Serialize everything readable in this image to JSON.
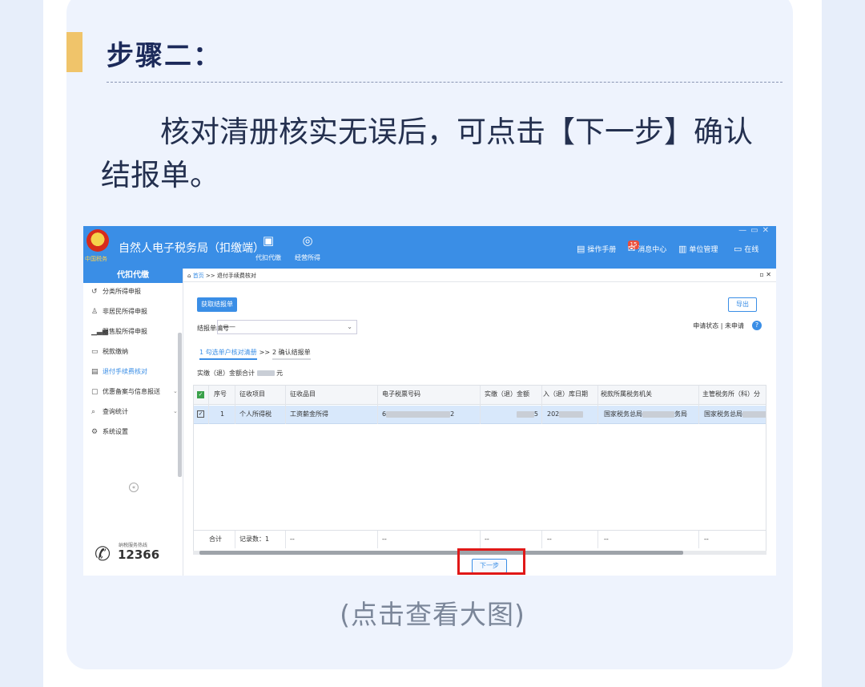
{
  "article": {
    "step_title": "步骤二：",
    "paragraph": "核对清册核实无误后，可点击【下一步】确认结报单。",
    "caption": "(点击查看大图)"
  },
  "app": {
    "title": "自然人电子税务局（扣缴端）",
    "logo_text": "中国税务",
    "nav": [
      {
        "icon": "wallet-icon",
        "label": "代扣代缴"
      },
      {
        "icon": "coins-icon",
        "label": "经营所得"
      }
    ],
    "top_right": {
      "manual": "操作手册",
      "messages": "消息中心",
      "message_count": "15",
      "unit_mgmt": "单位管理",
      "online": "在线"
    },
    "window_controls": [
      "—",
      "▭",
      "✕"
    ]
  },
  "sidebar": {
    "header": "代扣代缴",
    "items": [
      {
        "icon": "refresh-icon",
        "label": "分类所得申报"
      },
      {
        "icon": "person-icon",
        "label": "非居民所得申报"
      },
      {
        "icon": "bar-chart-icon",
        "label": "限售股所得申报"
      },
      {
        "icon": "card-icon",
        "label": "税款缴纳"
      },
      {
        "icon": "doc-icon",
        "label": "退付手续费核对"
      },
      {
        "icon": "doc-icon",
        "label": "优惠备案与信息报送"
      },
      {
        "icon": "search-icon",
        "label": "查询统计"
      },
      {
        "icon": "gear-icon",
        "label": "系统设置"
      }
    ],
    "hotline_label": "纳税服务热线",
    "hotline_number": "12366"
  },
  "main": {
    "breadcrumb_home": "首页",
    "breadcrumb_sep": ">>",
    "breadcrumb_page": "退付手续费核对",
    "get_button": "获取结报单",
    "export_button": "导出",
    "report_no_label": "结报单编号",
    "report_no_value": "——",
    "status_label": "申请状态",
    "status_sep": "|",
    "status_value": "未申请",
    "step1": "1 勾选单户核对清册",
    "step_arrow": ">>",
    "step2": "2 确认结报单",
    "total_label": "实缴（退）金额合计",
    "total_unit": "元",
    "next_button": "下一步",
    "table": {
      "columns": [
        "序号",
        "征收项目",
        "征收品目",
        "电子税票号码",
        "实缴（退）金额",
        "入（退）库日期",
        "税款所属税务机关",
        "主管税务所（科）分"
      ],
      "rows": [
        {
          "index": "1",
          "item": "个人所得税",
          "category": "工资薪金所得",
          "ticket_prefix": "6",
          "ticket_suffix": "2",
          "amount_suffix": "5",
          "date_prefix": "202",
          "authority_prefix": "国家税务总局",
          "authority_suffix": "务局",
          "office_prefix": "国家税务总局"
        }
      ],
      "footer": {
        "label": "合计",
        "count": "记录数：1",
        "dash": "--"
      }
    }
  }
}
